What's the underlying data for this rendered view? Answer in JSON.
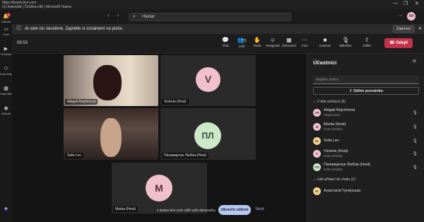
{
  "window": {
    "url": "https://teams.live.com",
    "title": "(1) Kalendář | Čeština ellě | Microsoft Teams",
    "controls": [
      "—",
      "❐",
      "✕"
    ]
  },
  "search": {
    "placeholder": "Hledat"
  },
  "user_avatar": "AR",
  "notification": {
    "text": "At vám nic neunikne. Zapněte si oznámení na ploše.",
    "button": "Zapnout",
    "close": "✕"
  },
  "rail": [
    {
      "label": "Aktivita",
      "icon": "bell-icon",
      "badge": "1"
    },
    {
      "label": "Chat",
      "icon": "chat-icon"
    },
    {
      "label": "Schůzka",
      "icon": "camera-icon"
    },
    {
      "label": "Komunity",
      "icon": "community-icon"
    },
    {
      "label": "Kalendář",
      "icon": "calendar-icon"
    },
    {
      "label": "Aktivita",
      "icon": "activity-icon"
    }
  ],
  "meeting": {
    "timer": "59:53",
    "toolbar": [
      {
        "label": "Chat",
        "glyph": "💬"
      },
      {
        "label": "Lidé",
        "glyph": "👥",
        "count": "5"
      },
      {
        "label": "Ruka",
        "glyph": "✋"
      },
      {
        "label": "Reagovat",
        "glyph": "☺"
      },
      {
        "label": "Zobrazení",
        "glyph": "▦"
      },
      {
        "label": "Více",
        "glyph": "⋯"
      },
      {
        "label": "Kamera",
        "glyph": "■"
      },
      {
        "label": "Mikrofon",
        "glyph": "🎙"
      },
      {
        "label": "Sdílet",
        "glyph": "⇧"
      }
    ],
    "leave": "Odejít",
    "tiles": [
      {
        "name": "Abigail Rejchrtová",
        "type": "video"
      },
      {
        "name": "Victoria (Host)",
        "initials": "V",
        "type": "avatar"
      },
      {
        "name": "Sofa Lev",
        "type": "video"
      },
      {
        "name": "Паламарчук Любов (Host)",
        "initials": "ПЛ",
        "type": "avatar"
      },
      {
        "name": "Marka (Host)",
        "initials": "M",
        "type": "avatar"
      }
    ],
    "sharing": {
      "text": "teams.live.com sdílí vaši obrazovku.",
      "stop": "Ukončit sdílení",
      "hide": "Skrýt"
    }
  },
  "panel": {
    "title": "Účastníci",
    "close": "✕",
    "search_placeholder": "Najděte jméno",
    "share_invite": "Sdílet pozvánku",
    "in_meeting_header": "V této schůzce (5)",
    "participants": [
      {
        "initials": "AR",
        "name": "Abigail Rejchrtová",
        "role": "Organizátor",
        "color": "#f0c1cc"
      },
      {
        "initials": "M",
        "name": "Mariia (Host)",
        "role": "Host schůzky",
        "color": "#f0c1cc"
      },
      {
        "initials": "SL",
        "name": "Sofa Lev",
        "role": "",
        "color": "#f0d28a"
      },
      {
        "initials": "V",
        "name": "Victoria (Host)",
        "role": "Host schůzky",
        "color": "#f0c1cc"
      },
      {
        "initials": "ПЛ",
        "name": "Паламарчук Любов (Host)",
        "role": "Host schůzky",
        "color": "#cce8c8"
      }
    ],
    "chat_header": "Lidé přidaní do chatu (1)",
    "chat_people": [
      {
        "initials": "AГ",
        "name": "Анастасія Гулянська",
        "color": "#f0d28a"
      }
    ]
  },
  "colors": {
    "leave": "#c4314b",
    "stop_share": "#b7c8f3",
    "avatar_pink": "#f0c1cc",
    "avatar_green": "#cce8c8"
  }
}
